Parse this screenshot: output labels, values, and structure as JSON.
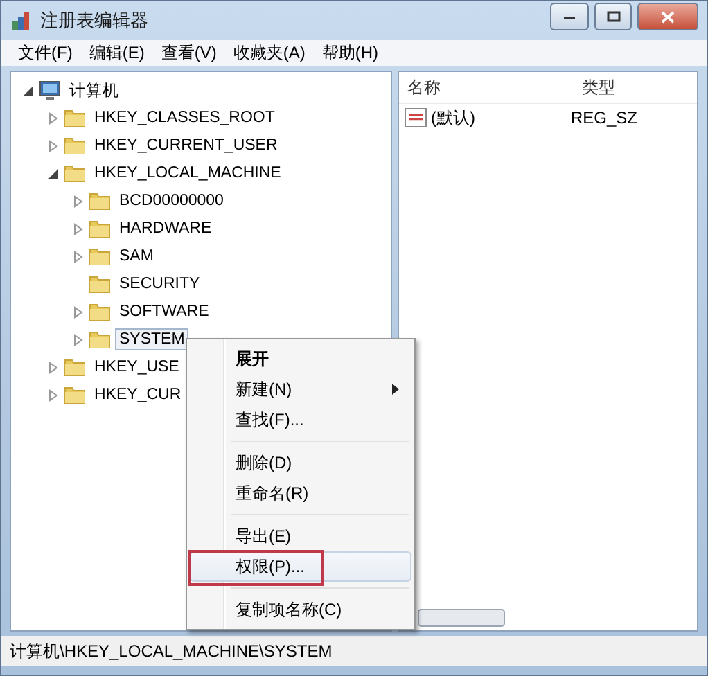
{
  "window": {
    "title": "注册表编辑器"
  },
  "menu_bar": [
    {
      "label": "文件(F)"
    },
    {
      "label": "编辑(E)"
    },
    {
      "label": "查看(V)"
    },
    {
      "label": "收藏夹(A)"
    },
    {
      "label": "帮助(H)"
    }
  ],
  "tree": [
    {
      "label": "计算机",
      "kind": "computer",
      "expanded": true,
      "selected": false,
      "children": [
        {
          "label": "HKEY_CLASSES_ROOT",
          "kind": "folder",
          "expanded": false,
          "selected": false
        },
        {
          "label": "HKEY_CURRENT_USER",
          "kind": "folder",
          "expanded": false,
          "selected": false
        },
        {
          "label": "HKEY_LOCAL_MACHINE",
          "kind": "folder",
          "expanded": true,
          "selected": false,
          "children": [
            {
              "label": "BCD00000000",
              "kind": "folder",
              "expanded": false,
              "selected": false
            },
            {
              "label": "HARDWARE",
              "kind": "folder",
              "expanded": false,
              "selected": false
            },
            {
              "label": "SAM",
              "kind": "folder",
              "expanded": false,
              "selected": false
            },
            {
              "label": "SECURITY",
              "kind": "leaf",
              "selected": false
            },
            {
              "label": "SOFTWARE",
              "kind": "folder",
              "expanded": false,
              "selected": false
            },
            {
              "label": "SYSTEM",
              "kind": "folder",
              "expanded": false,
              "selected": true
            }
          ]
        },
        {
          "label": "HKEY_USE",
          "kind": "folder",
          "expanded": false,
          "selected": false
        },
        {
          "label": "HKEY_CUR",
          "kind": "folder",
          "expanded": false,
          "selected": false
        }
      ]
    }
  ],
  "values_list": {
    "columns": [
      "名称",
      "类型"
    ],
    "rows": [
      {
        "name": "(默认)",
        "type": "REG_SZ"
      }
    ]
  },
  "context_menu": [
    {
      "kind": "item",
      "label": "展开",
      "default": true,
      "submenu": false,
      "selected": false,
      "marked": false
    },
    {
      "kind": "item",
      "label": "新建(N)",
      "default": false,
      "submenu": true,
      "selected": false,
      "marked": false
    },
    {
      "kind": "item",
      "label": "查找(F)...",
      "default": false,
      "submenu": false,
      "selected": false,
      "marked": false
    },
    {
      "kind": "separator"
    },
    {
      "kind": "item",
      "label": "删除(D)",
      "default": false,
      "submenu": false,
      "selected": false,
      "marked": false
    },
    {
      "kind": "item",
      "label": "重命名(R)",
      "default": false,
      "submenu": false,
      "selected": false,
      "marked": false
    },
    {
      "kind": "separator"
    },
    {
      "kind": "item",
      "label": "导出(E)",
      "default": false,
      "submenu": false,
      "selected": false,
      "marked": false
    },
    {
      "kind": "item",
      "label": "权限(P)...",
      "default": false,
      "submenu": false,
      "selected": true,
      "marked": true
    },
    {
      "kind": "separator"
    },
    {
      "kind": "item",
      "label": "复制项名称(C)",
      "default": false,
      "submenu": false,
      "selected": false,
      "marked": false
    }
  ],
  "status_bar": {
    "path": "计算机\\HKEY_LOCAL_MACHINE\\SYSTEM"
  }
}
